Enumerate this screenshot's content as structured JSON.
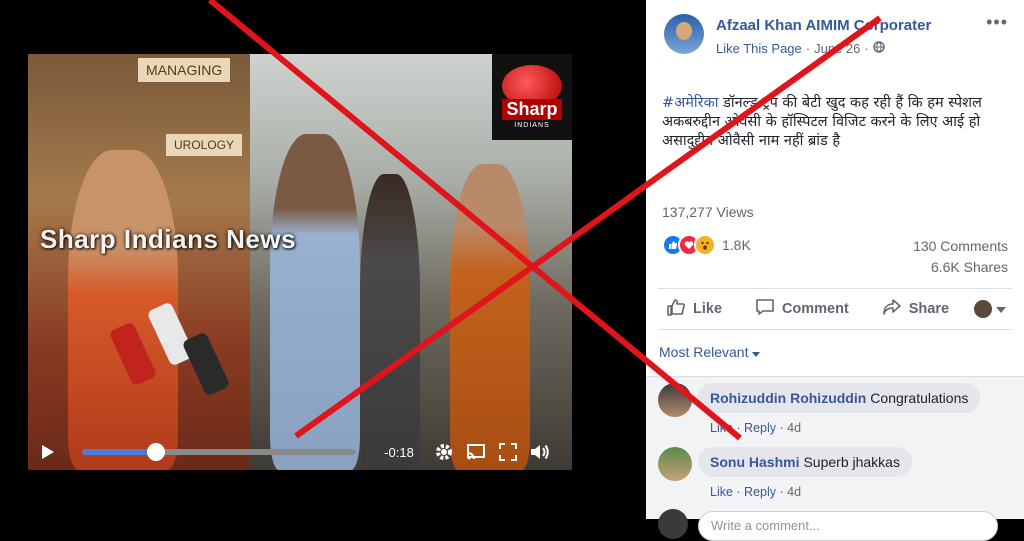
{
  "video": {
    "watermark": "Sharp Indians News",
    "logo_text": "Sharp",
    "logo_subtext": "INDIANS",
    "scene_sign": "MANAGING",
    "scene_sign2": "UROLOGY",
    "time_remaining": "-0:18",
    "progress_fraction": 0.27,
    "controls": {
      "play_icon": "play-icon",
      "settings_icon": "gear-icon",
      "cast_icon": "cast-icon",
      "fullscreen_icon": "fullscreen-icon",
      "volume_icon": "volume-icon"
    }
  },
  "post": {
    "page_name": "Afzaal Khan AIMIM Corporater",
    "like_page": "Like This Page",
    "separator": "·",
    "date": "June 26",
    "more": "•••",
    "hashtag": "#अमेरिका",
    "text": " डॉनल्ड ट्रंप की बेटी खुद कह रही हैं कि हम स्पेशल अकबरुद्दीन ओवैसी के हॉस्पिटल विजिट करने के लिए आई हो असादुद्दीन ओवैसी नाम नहीं ब्रांड है",
    "views": "137,277 Views",
    "reaction_count": "1.8K",
    "comments_count": "130 Comments",
    "shares_count": "6.6K Shares"
  },
  "actions": {
    "like": "Like",
    "comment": "Comment",
    "share": "Share"
  },
  "sort_label": "Most Relevant",
  "comments": [
    {
      "name": "Rohizuddin Rohizuddin",
      "text": "Congratulations",
      "like": "Like",
      "reply": "Reply",
      "time": "4d"
    },
    {
      "name": "Sonu Hashmi",
      "text": "Superb jhakkas",
      "like": "Like",
      "reply": "Reply",
      "time": "4d"
    }
  ],
  "write_placeholder": "Write a comment...",
  "colors": {
    "cross": "#e0141b",
    "link": "#365899",
    "progress": "#4a7cd8"
  }
}
